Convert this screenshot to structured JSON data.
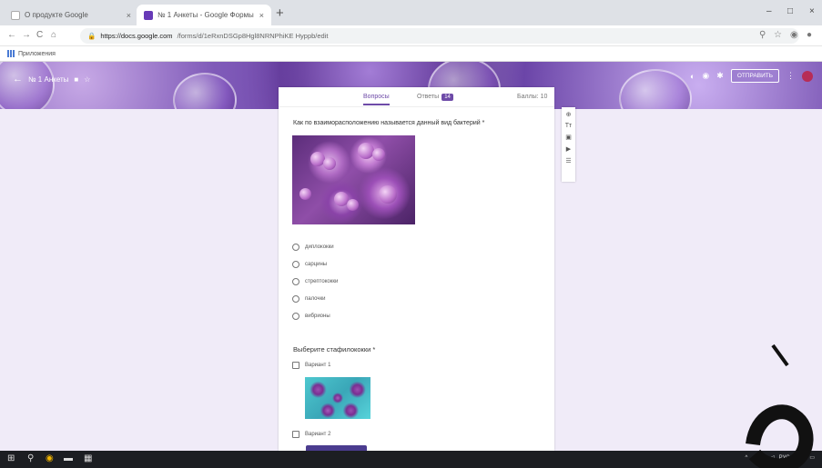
{
  "browser": {
    "tabs": [
      {
        "title": "О продукте Google",
        "favicon_color": "#5f6368"
      },
      {
        "title": "№ 1 Анкеты - Google Формы",
        "favicon_color": "#673ab7"
      }
    ],
    "url_domain": "https://docs.google.com",
    "url_path": "/forms/d/1eRxnDSGp8Hgl8NRNPhiKE Hyppb/edit",
    "bookmarks_label": "Приложения"
  },
  "header": {
    "doc_title": "№ 1 Анкеты",
    "send_label": "ОТПРАВИТЬ"
  },
  "card": {
    "tabs": {
      "questions": "Вопросы",
      "answers": "Ответы",
      "answers_count": "14",
      "total": "Баллы: 10"
    },
    "q1": {
      "text": "Как по взаиморасположению называется данный вид бактерий *",
      "options": [
        "диплококки",
        "сарцины",
        "стрептококки",
        "палочки",
        "вибрионы"
      ]
    },
    "q2": {
      "text": "Выберите стафилококки *",
      "options": [
        "Вариант 1",
        "Вариант 2"
      ]
    }
  },
  "tray": {
    "lang": "РУС",
    "time": "0:47"
  },
  "colors": {
    "accent": "#673ab7",
    "background": "#f0ebf8",
    "taskbar": "#1c1e22"
  }
}
